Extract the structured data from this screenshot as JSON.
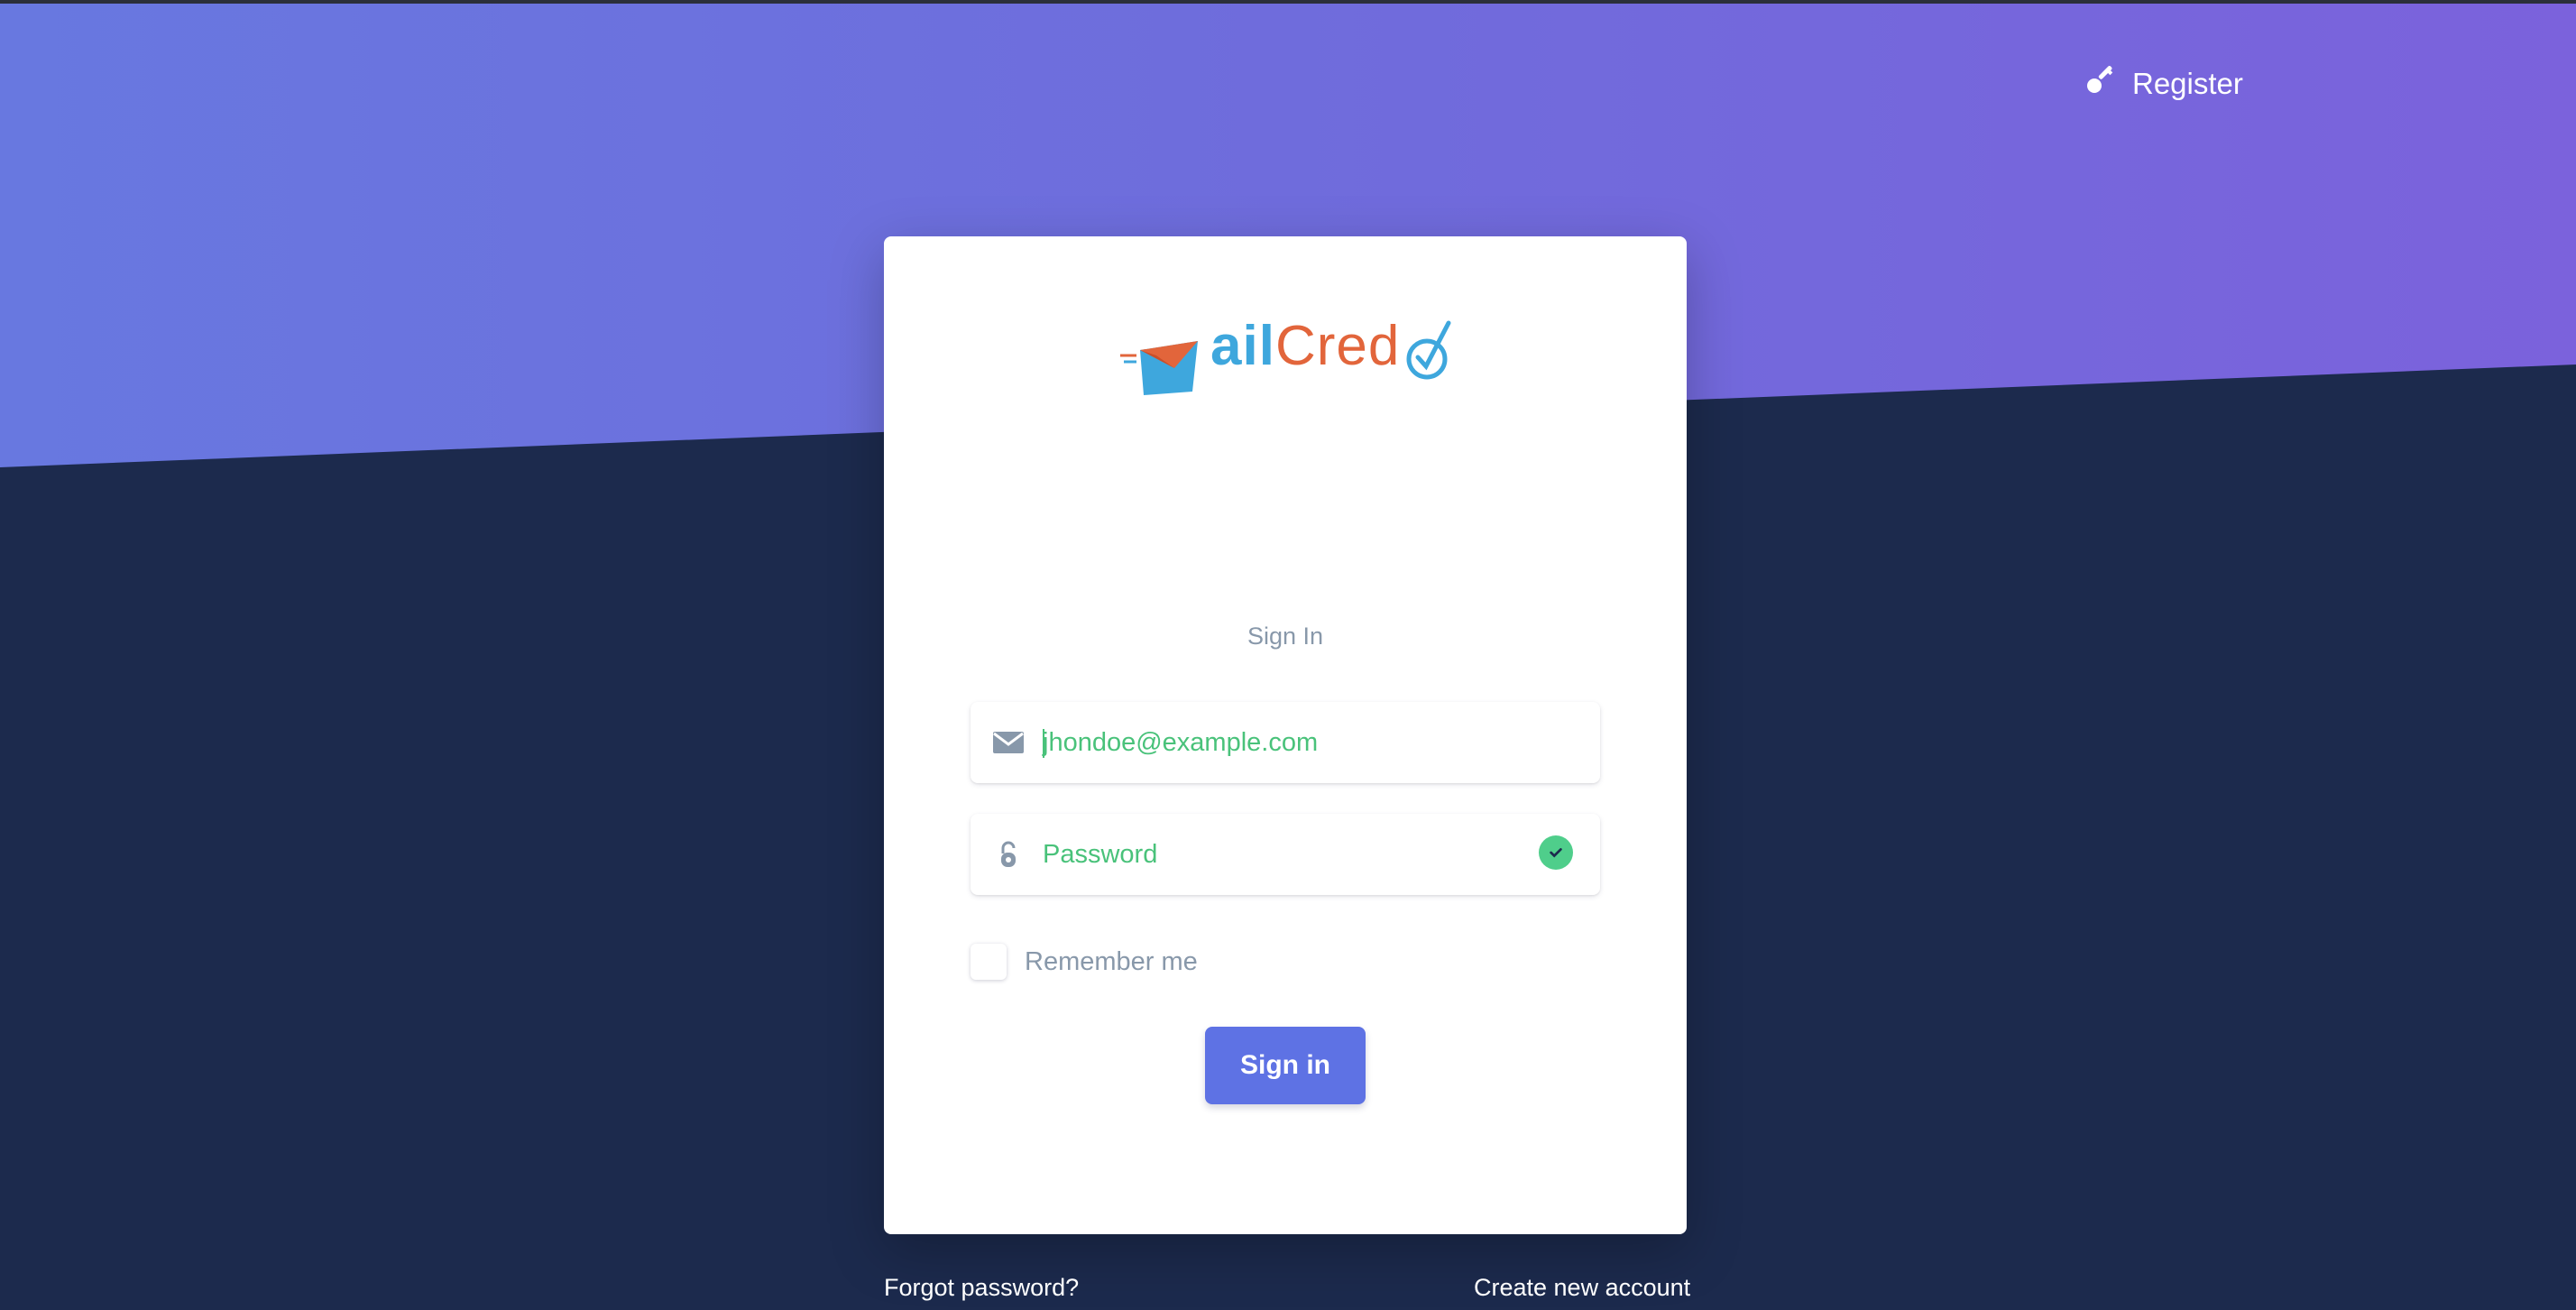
{
  "header": {
    "register_label": "Register",
    "register_icon": "key-icon"
  },
  "logo": {
    "part_ai": "ail",
    "part_cred": "Cred",
    "icon": "envelope-check-logo"
  },
  "form": {
    "title": "Sign In",
    "email": {
      "value": "jhondoe@example.com",
      "icon": "envelope-icon"
    },
    "password": {
      "placeholder": "Password",
      "icon": "unlock-icon",
      "valid_icon": "check-circle-icon"
    },
    "remember_label": "Remember me",
    "submit_label": "Sign in"
  },
  "footer": {
    "forgot_label": "Forgot password?",
    "create_label": "Create new account"
  },
  "colors": {
    "hero_start": "#6878e0",
    "hero_end": "#7b62dc",
    "background": "#1c2a4d",
    "primary": "#5e72e4",
    "success": "#4fce8b",
    "logo_blue": "#3ea7dd",
    "logo_orange": "#e2653b"
  }
}
